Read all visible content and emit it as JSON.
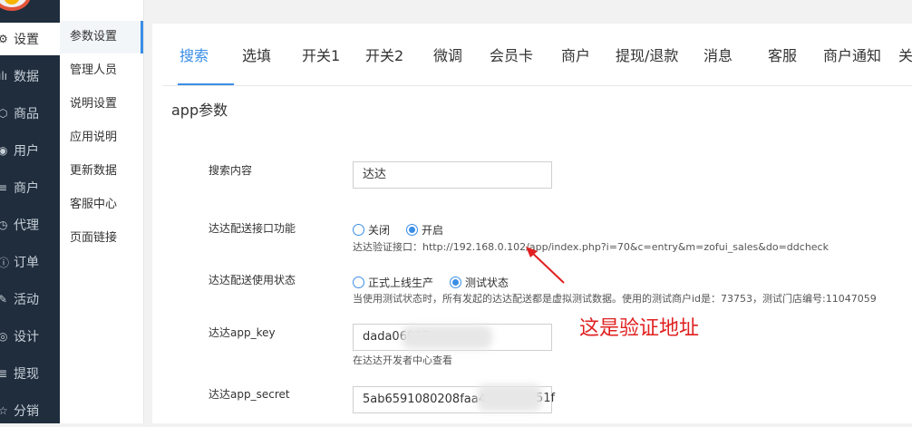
{
  "sidebar": {
    "items": [
      {
        "icon": "gear-icon",
        "label": "设置"
      },
      {
        "icon": "bar-chart-icon",
        "label": "数据"
      },
      {
        "icon": "box-icon",
        "label": "商品"
      },
      {
        "icon": "user-icon",
        "label": "用户"
      },
      {
        "icon": "list-icon",
        "label": "商户"
      },
      {
        "icon": "clock-icon",
        "label": "代理"
      },
      {
        "icon": "info-icon",
        "label": "订单"
      },
      {
        "icon": "edit-icon",
        "label": "活动"
      },
      {
        "icon": "palette-icon",
        "label": "设计"
      },
      {
        "icon": "list-icon",
        "label": "提现"
      },
      {
        "icon": "star-icon",
        "label": "分销"
      }
    ]
  },
  "submenu": {
    "items": [
      "参数设置",
      "管理人员",
      "说明设置",
      "应用说明",
      "更新数据",
      "客服中心",
      "页面链接"
    ]
  },
  "tabs": [
    "搜索",
    "选填",
    "开关1",
    "开关2",
    "微调",
    "会员卡",
    "商户",
    "提现/退款",
    "消息",
    "客服",
    "商户通知",
    "关"
  ],
  "section_title": "app参数",
  "form": {
    "search_label": "搜索内容",
    "search_value": "达达",
    "api_label": "达达配送接口功能",
    "api_off": "关闭",
    "api_on": "开启",
    "api_verify": "达达验证接口：http://192.168.0.102/app/index.php?i=70&c=entry&m=zofui_sales&do=ddcheck",
    "status_label": "达达配送使用状态",
    "status_prod": "正式上线生产",
    "status_test": "测试状态",
    "status_help": "当使用测试状态时，所有发起的达达配送都是虚拟测试数据。使用的测试商户id是：73753，测试门店编号:11047059",
    "appkey_label": "达达app_key",
    "appkey_value": "dada06925e",
    "appkey_help": "在达达开发者中心查看",
    "secret_label": "达达app_secret",
    "secret_value": "5ab6591080208faa4",
    "secret_tail": "51f"
  },
  "annotation": "这是验证地址",
  "colors": {
    "accent": "#3a8ee6",
    "annotation": "#e02020",
    "sidebar": "#1f2d3d"
  }
}
